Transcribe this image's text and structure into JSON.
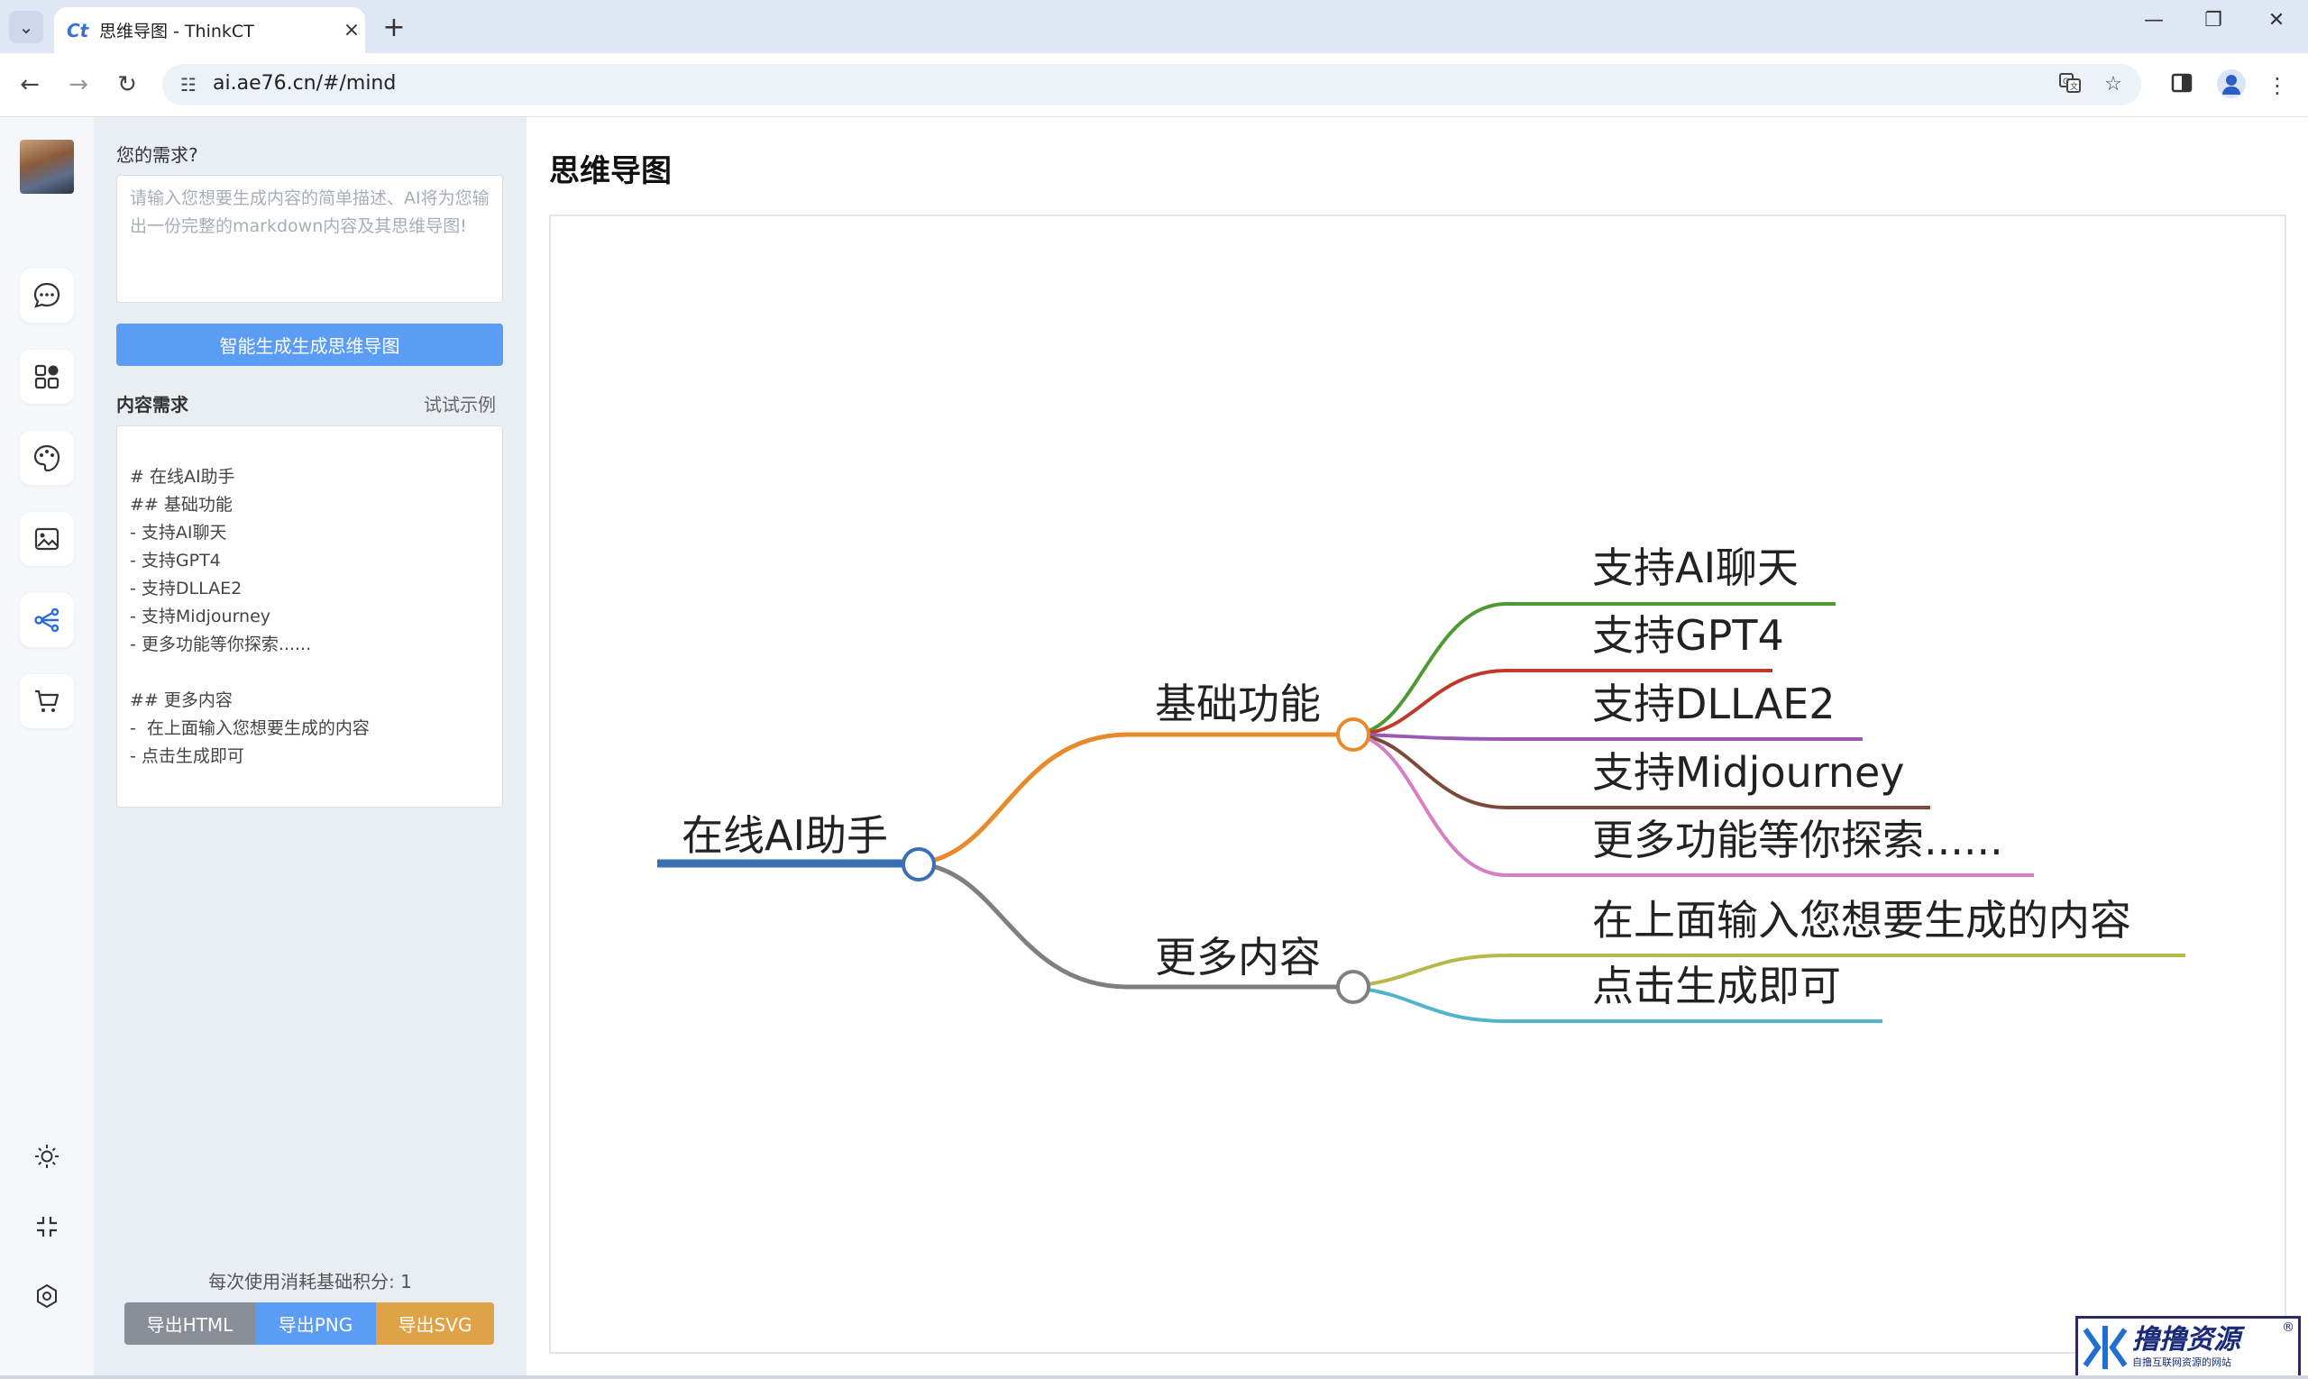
{
  "browser": {
    "tab_title": "思维导图 - ThinkCT",
    "tab_logo": "Ct",
    "url": "ai.ae76.cn/#/mind",
    "win_min": "—",
    "win_restore": "❐",
    "win_close": "✕"
  },
  "sidebar": {
    "items": [
      {
        "name": "chat-icon"
      },
      {
        "name": "apps-icon"
      },
      {
        "name": "palette-icon"
      },
      {
        "name": "image-icon"
      },
      {
        "name": "mindmap-icon"
      },
      {
        "name": "cart-icon"
      }
    ],
    "bottom": [
      {
        "name": "theme-icon"
      },
      {
        "name": "collapse-icon"
      },
      {
        "name": "settings-icon"
      }
    ]
  },
  "panel": {
    "need_label": "您的需求?",
    "need_placeholder": "请输入您想要生成内容的简单描述、AI将为您输出一份完整的markdown内容及其思维导图!",
    "generate_button": "智能生成生成思维导图",
    "content_label": "内容需求",
    "try_example": "试试示例",
    "content_text": "\n# 在线AI助手\n## 基础功能\n- 支持AI聊天\n- 支持GPT4\n- 支持DLLAE2\n- 支持Midjourney\n- 更多功能等你探索......\n\n## 更多内容\n-  在上面输入您想要生成的内容\n- 点击生成即可",
    "cost_text": "每次使用消耗基础积分:  1",
    "export_html": "导出HTML",
    "export_png": "导出PNG",
    "export_svg": "导出SVG"
  },
  "main": {
    "title": "思维导图"
  },
  "mindmap": {
    "root": "在线AI助手",
    "branches": [
      {
        "label": "基础功能",
        "color": "#e8892b",
        "children": [
          {
            "label": "支持AI聊天",
            "color": "#4e9a2e"
          },
          {
            "label": "支持GPT4",
            "color": "#c0392b"
          },
          {
            "label": "支持DLLAE2",
            "color": "#9b59b6"
          },
          {
            "label": "支持Midjourney",
            "color": "#7b4a3a"
          },
          {
            "label": "更多功能等你探索......",
            "color": "#d67fc4"
          }
        ]
      },
      {
        "label": "更多内容",
        "color": "#7f7f7f",
        "children": [
          {
            "label": "在上面输入您想要生成的内容",
            "color": "#b8b84a"
          },
          {
            "label": "点击生成即可",
            "color": "#4fb4cc"
          }
        ]
      }
    ],
    "root_color": "#3a6fb5"
  },
  "watermark": {
    "text": "撸撸资源",
    "sub": "自撸互联网资源的网站",
    "reg": "®"
  }
}
